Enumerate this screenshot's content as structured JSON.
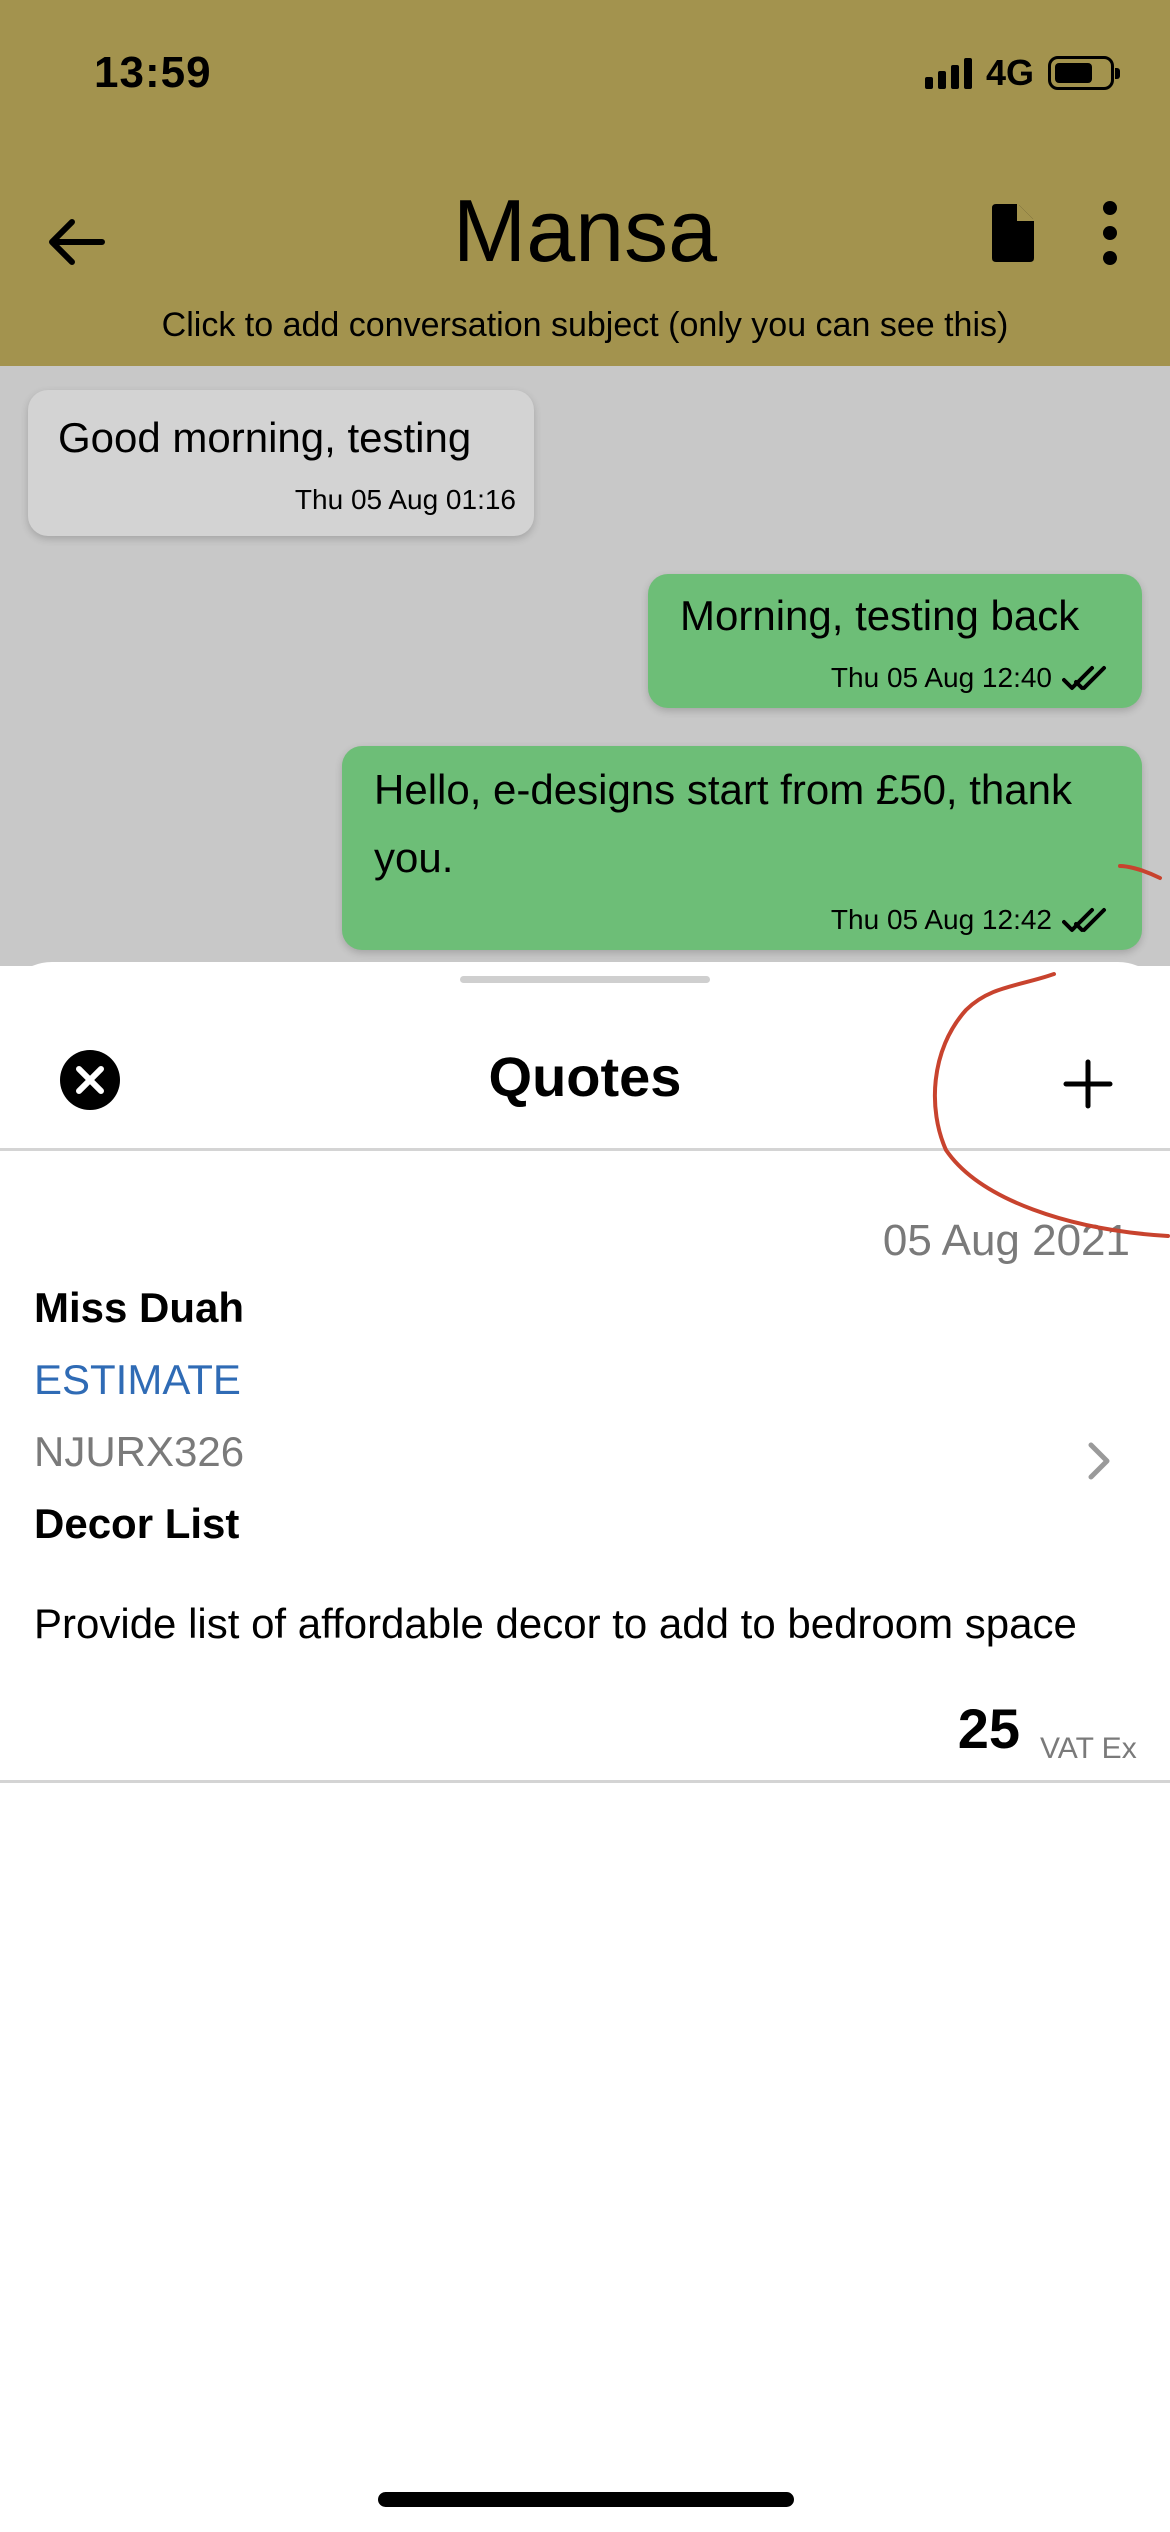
{
  "status_bar": {
    "time": "13:59",
    "network": "4G"
  },
  "header": {
    "title": "Mansa",
    "subject_hint": "Click to add conversation subject (only you can see this)"
  },
  "messages": [
    {
      "direction": "in",
      "text": "Good morning, testing",
      "time": "Thu 05 Aug 01:16"
    },
    {
      "direction": "out",
      "text": "Morning, testing back",
      "time": "Thu 05 Aug 12:40"
    },
    {
      "direction": "out",
      "text": "Hello, e-designs start from £50, thank you.",
      "time": "Thu 05 Aug 12:42"
    }
  ],
  "sheet": {
    "title": "Quotes",
    "quote": {
      "date": "05 Aug 2021",
      "customer": "Miss Duah",
      "type": "ESTIMATE",
      "reference": "NJURX326",
      "title": "Decor List",
      "description": "Provide list of affordable decor to add to bedroom space",
      "amount": "25",
      "vat_label": "VAT Ex"
    }
  },
  "colors": {
    "header_bg": "#a3934e",
    "chat_bg": "#c8c8c8",
    "incoming_bubble": "#d3d3d3",
    "outgoing_bubble": "#6dbe77",
    "estimate_blue": "#2f6bb5",
    "annotation_red": "#c8432e"
  }
}
